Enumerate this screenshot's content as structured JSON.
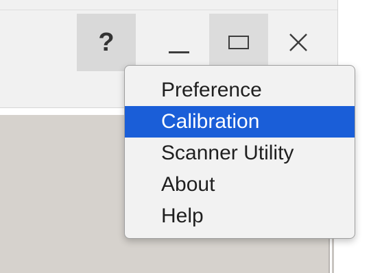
{
  "window_controls": {
    "help_label": "?",
    "minimize_icon": "minimize-icon",
    "maximize_icon": "maximize-icon",
    "close_icon": "close-icon"
  },
  "menu": {
    "items": [
      {
        "label": "Preference",
        "selected": false
      },
      {
        "label": "Calibration",
        "selected": true
      },
      {
        "label": "Scanner Utility",
        "selected": false
      },
      {
        "label": "About",
        "selected": false
      },
      {
        "label": "Help",
        "selected": false
      }
    ],
    "selected_color": "#1a5ed8"
  }
}
